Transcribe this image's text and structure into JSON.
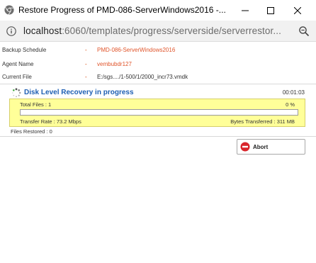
{
  "window": {
    "title": "Restore Progress of PMD-086-ServerWindows2016 -...",
    "minimize_icon": "minimize-icon",
    "maximize_icon": "maximize-icon",
    "close_icon": "close-icon"
  },
  "address_bar": {
    "host": "localhost",
    "path": ":6060/templates/progress/serverside/serverrestor...",
    "info_icon": "info-icon",
    "zoom_icon": "zoom-icon"
  },
  "fields": [
    {
      "label": "Backup Schedule",
      "dash": "-",
      "value": "PMD-086-ServerWindows2016"
    },
    {
      "label": "Agent Name",
      "dash": "-",
      "value": "vembubdr127"
    },
    {
      "label": "Current File",
      "dash": "-",
      "value": "E:/sgs..../1-500/1/2000_incr73.vmdk"
    }
  ],
  "recovery": {
    "title": "Disk Level Recovery in progress",
    "elapsed": "00:01:03",
    "spinner_icon": "spinner-icon"
  },
  "progress": {
    "total_files": "Total Files : 1",
    "percent_label": "0 %",
    "percent_value": 0,
    "transfer_rate": "Transfer Rate :  73.2 Mbps",
    "bytes_transferred": "Bytes Transferred :  311 MB"
  },
  "files_restored": "Files Restored : 0",
  "abort_button": {
    "label": "Abort",
    "icon": "stop-icon"
  },
  "colors": {
    "accent_blue": "#1e5fb3",
    "value_orange": "#e0542a",
    "panel_yellow": "#ffff99",
    "abort_red": "#d9262c"
  }
}
